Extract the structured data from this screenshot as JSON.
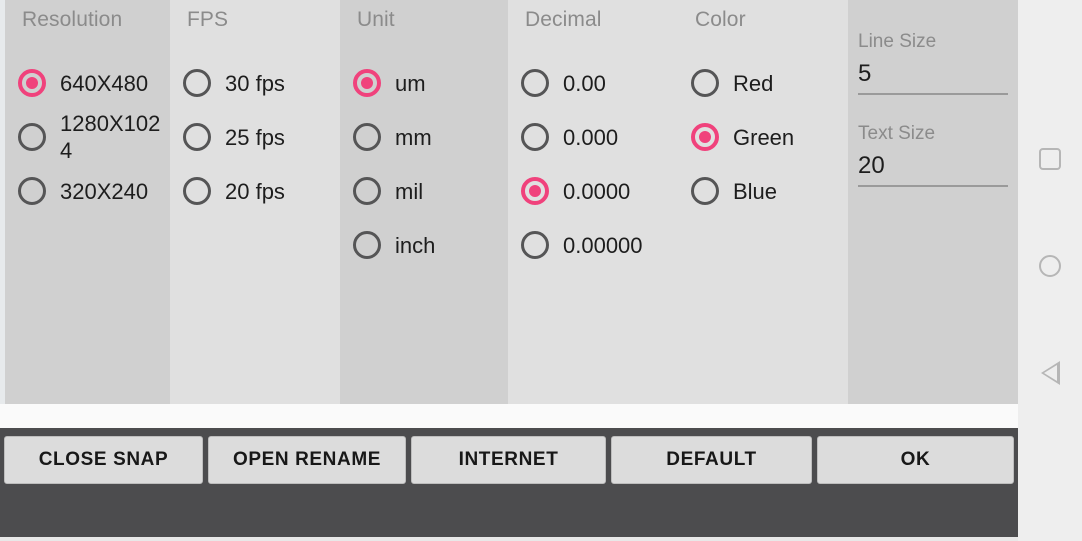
{
  "colors": {
    "accent_pink": "#f0427c",
    "radio_unselected": "#555556",
    "column_dark": "#d0d0d0",
    "column_light": "#e0e0e0",
    "button_bar": "#4c4c4e",
    "button_face": "#dcdcdc",
    "nav_bar": "#eeeeee",
    "title_text": "#8b8b8b",
    "body_text": "#1d1d1d"
  },
  "columns": {
    "resolution": {
      "title": "Resolution",
      "options": [
        {
          "label": "640X480",
          "selected": true
        },
        {
          "label": "1280X1024",
          "selected": false
        },
        {
          "label": "320X240",
          "selected": false
        }
      ]
    },
    "fps": {
      "title": "FPS",
      "options": [
        {
          "label": "30 fps",
          "selected": false
        },
        {
          "label": "25 fps",
          "selected": false
        },
        {
          "label": "20 fps",
          "selected": false
        }
      ]
    },
    "unit": {
      "title": "Unit",
      "options": [
        {
          "label": "um",
          "selected": true
        },
        {
          "label": "mm",
          "selected": false
        },
        {
          "label": "mil",
          "selected": false
        },
        {
          "label": "inch",
          "selected": false
        }
      ]
    },
    "decimal": {
      "title": "Decimal",
      "options": [
        {
          "label": "0.00",
          "selected": false
        },
        {
          "label": "0.000",
          "selected": false
        },
        {
          "label": "0.0000",
          "selected": true
        },
        {
          "label": "0.00000",
          "selected": false
        }
      ]
    },
    "color": {
      "title": "Color",
      "options": [
        {
          "label": "Red",
          "selected": false
        },
        {
          "label": "Green",
          "selected": true
        },
        {
          "label": "Blue",
          "selected": false
        }
      ]
    },
    "sizes": {
      "line_size": {
        "label": "Line Size",
        "value": "5"
      },
      "text_size": {
        "label": "Text Size",
        "value": "20"
      }
    }
  },
  "button_bar": {
    "buttons": [
      {
        "id": "close-snap",
        "label": "CLOSE SNAP"
      },
      {
        "id": "open-rename",
        "label": "OPEN RENAME"
      },
      {
        "id": "internet",
        "label": "INTERNET"
      },
      {
        "id": "default",
        "label": "DEFAULT"
      },
      {
        "id": "ok",
        "label": "OK"
      }
    ]
  },
  "nav_bar": {
    "recents_icon": "square-icon",
    "home_icon": "circle-icon",
    "back_icon": "triangle-back-icon"
  }
}
